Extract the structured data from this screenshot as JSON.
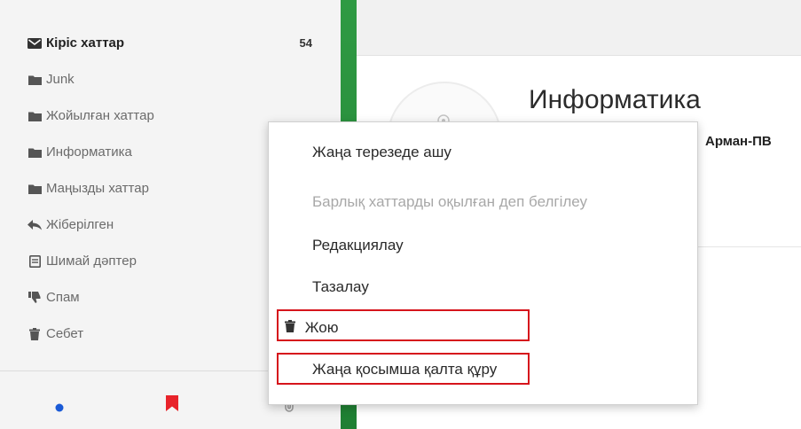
{
  "sidebar": {
    "folders": [
      {
        "label": "Кіріс хаттар",
        "icon": "envelope-icon",
        "count": "54",
        "active": true
      },
      {
        "label": "Junk",
        "icon": "folder-icon"
      },
      {
        "label": "Жойылған хаттар",
        "icon": "folder-icon"
      },
      {
        "label": "Информатика",
        "icon": "folder-icon"
      },
      {
        "label": "Маңызды хаттар",
        "icon": "folder-icon"
      },
      {
        "label": "Жіберілген",
        "icon": "reply-icon"
      },
      {
        "label": "Шимай дәптер",
        "icon": "draft-icon"
      },
      {
        "label": "Спам",
        "icon": "thumbs-down-icon"
      },
      {
        "label": "Себет",
        "icon": "trash-icon"
      }
    ],
    "footer_icons": [
      "unread-dot-icon",
      "flag-icon",
      "attachment-icon"
    ]
  },
  "main": {
    "folder_title": "Информатика",
    "subtitle": "Арман-ПВ"
  },
  "context_menu": {
    "items": [
      {
        "label": "Жаңа терезеде ашу",
        "enabled": true
      },
      {
        "label": "Барлық хаттарды оқылған деп белгілеу",
        "enabled": false
      },
      {
        "label": "Редакциялау",
        "enabled": true
      },
      {
        "label": "Тазалау",
        "enabled": true
      },
      {
        "label": "Жою",
        "enabled": true,
        "icon": "trash-icon",
        "highlighted": true
      },
      {
        "label": "Жаңа қосымша қалта құру",
        "enabled": true,
        "highlighted": true
      }
    ]
  },
  "colors": {
    "accent_green": "#2f9a43",
    "highlight_red": "#d6141c",
    "unread_blue": "#1a5ad6",
    "flag_red": "#e8232a"
  }
}
